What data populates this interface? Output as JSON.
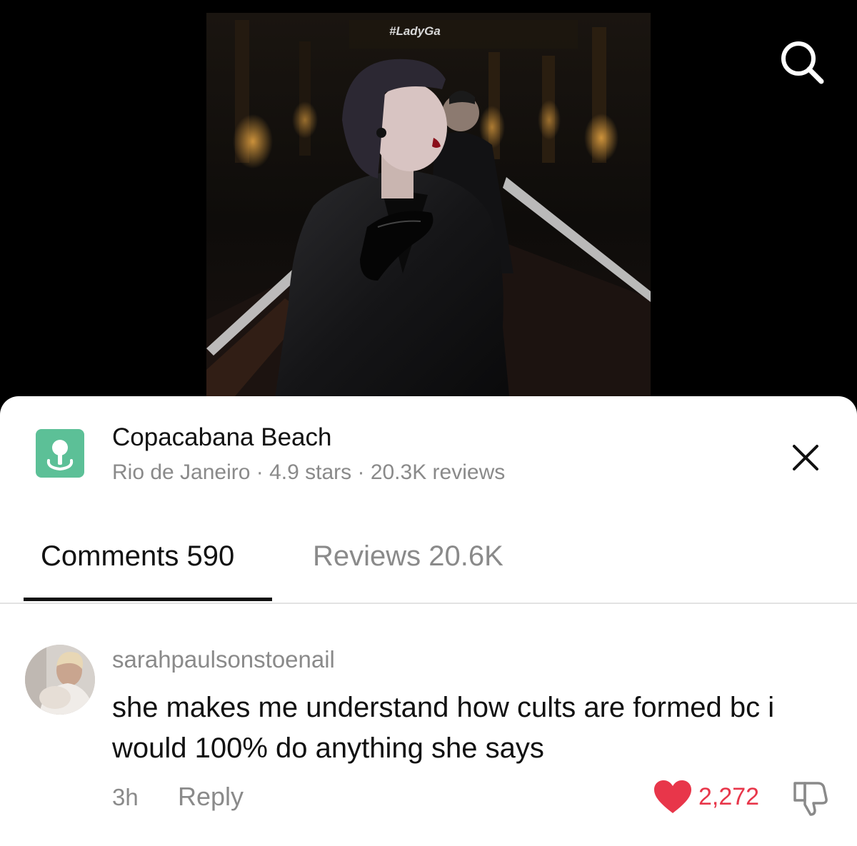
{
  "video": {
    "watermark": "#LadyGa"
  },
  "place": {
    "title": "Copacabana Beach",
    "subtitle": "Rio de Janeiro · 4.9 stars · 20.3K reviews",
    "icon": "map-pin-icon",
    "icon_color": "#5cc097"
  },
  "tabs": [
    {
      "label": "Comments 590",
      "active": true
    },
    {
      "label": "Reviews 20.6K",
      "active": false
    }
  ],
  "comment": {
    "username": "sarahpaulsonstoenail",
    "text": "she makes me understand how cults are formed bc i would 100% do anything she says",
    "time": "3h",
    "reply_label": "Reply",
    "likes": "2,272",
    "like_color": "#e8364a"
  }
}
